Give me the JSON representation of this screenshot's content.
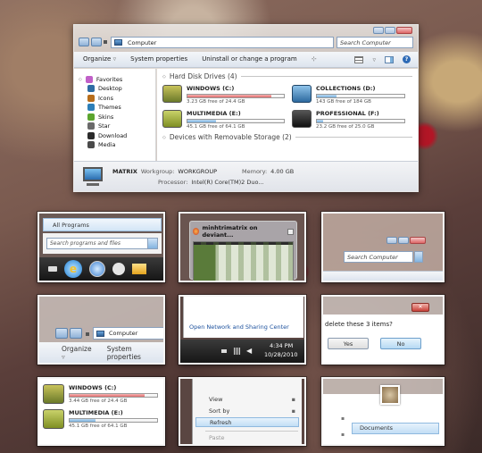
{
  "explorer": {
    "address": "Computer",
    "search_placeholder": "Search Computer",
    "toolbar": [
      "Organize",
      "System properties",
      "Uninstall or change a program"
    ],
    "sidebar": [
      {
        "label": "Favorites",
        "icon": "star-icon",
        "color": "#c060c8"
      },
      {
        "label": "Desktop",
        "icon": "desktop-icon",
        "color": "#2e6da4"
      },
      {
        "label": "Icons",
        "icon": "icons-icon",
        "color": "#b86e1b"
      },
      {
        "label": "Themes",
        "icon": "themes-icon",
        "color": "#2d7fb8"
      },
      {
        "label": "Skins",
        "icon": "skins-icon",
        "color": "#5ca52f"
      },
      {
        "label": "Star",
        "icon": "star-folder-icon",
        "color": "#6a6a6a"
      },
      {
        "label": "Download",
        "icon": "download-icon",
        "color": "#2b2b2b"
      },
      {
        "label": "Media",
        "icon": "media-icon",
        "color": "#4a4a4a"
      }
    ],
    "hdd_header": "Hard Disk Drives (4)",
    "drives": [
      {
        "name": "WINDOWS (C:)",
        "free": "3.23 GB free of 24.4 GB",
        "used": 0.87,
        "bar": "red",
        "icon": "windows-drive-icon",
        "color": "#6b7a2a"
      },
      {
        "name": "COLLECTIONS (D:)",
        "free": "143 GB free of 184 GB",
        "used": 0.22,
        "bar": "blue",
        "icon": "collections-drive-icon",
        "color": "#3a86c4"
      },
      {
        "name": "MULTIMEDIA (E:)",
        "free": "45.1 GB free of 64.1 GB",
        "used": 0.3,
        "bar": "blue",
        "icon": "multimedia-drive-icon",
        "color": "#7f8f23"
      },
      {
        "name": "PROFESSIONAL (F:)",
        "free": "23.2 GB free of 25.0 GB",
        "used": 0.07,
        "bar": "blue",
        "icon": "professional-drive-icon",
        "color": "#222222"
      }
    ],
    "removable_header": "Devices with Removable Storage (2)",
    "details": {
      "computer": "MATRIX",
      "workgroup_label": "Workgroup:",
      "workgroup": "WORKGROUP",
      "memory_label": "Memory:",
      "memory": "4.00 GB",
      "processor_label": "Processor:",
      "processor": "Intel(R) Core(TM)2 Duo..."
    }
  },
  "start_menu": {
    "all_programs": "All Programs",
    "search_placeholder": "Search programs and files"
  },
  "thumbnail": {
    "title": "minhtrimatrix on deviant..."
  },
  "search_zoom": {
    "placeholder": "Search Computer"
  },
  "delete_dialog": {
    "text": "delete these 3 items?",
    "yes": "Yes",
    "no": "No"
  },
  "explorer_zoom": {
    "address": "Computer",
    "organize": "Organize",
    "system_properties": "System properties"
  },
  "tray": {
    "network": "Open Network and Sharing Center",
    "time": "4:34 PM",
    "date": "10/28/2010"
  },
  "drives_zoom": [
    {
      "name": "WINDOWS (C:)",
      "free": "3.44 GB free of 24.4 GB",
      "used": 0.86,
      "bar": "red"
    },
    {
      "name": "MULTIMEDIA (E:)",
      "free": "45.1 GB free of 64.1 GB",
      "used": 0.3,
      "bar": "blue"
    }
  ],
  "context_menu": {
    "items": [
      "View",
      "Sort by",
      "Refresh",
      "Paste"
    ]
  },
  "library": {
    "label": "Documents"
  }
}
